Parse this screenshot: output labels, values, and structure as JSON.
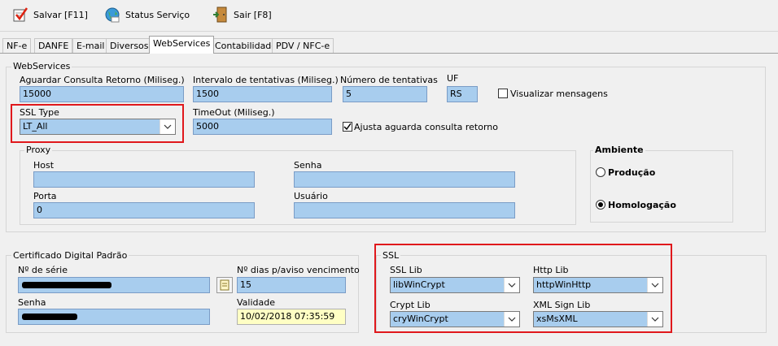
{
  "toolbar": {
    "save_label": "Salvar [F11]",
    "status_label": "Status Serviço",
    "exit_label": "Sair [F8]"
  },
  "tabs": [
    "NF-e",
    "DANFE",
    "E-mail",
    "Diversos",
    "WebServices",
    "Contabilidade",
    "PDV / NFC-e"
  ],
  "active_tab": "WebServices",
  "webservices": {
    "title": "WebServices",
    "aguardar_label": "Aguardar Consulta Retorno (Miliseg.)",
    "aguardar_value": "15000",
    "intervalo_label": "Intervalo de tentativas (Miliseg.)",
    "intervalo_value": "1500",
    "tentativas_label": "Número de tentativas",
    "tentativas_value": "5",
    "uf_label": "UF",
    "uf_value": "RS",
    "visualizar_label": "Visualizar mensagens",
    "visualizar_checked": false,
    "ssltype_label": "SSL Type",
    "ssltype_value": "LT_All",
    "timeout_label": "TimeOut (Miliseg.)",
    "timeout_value": "5000",
    "ajusta_label": "Ajusta aguarda consulta retorno",
    "ajusta_checked": true
  },
  "proxy": {
    "title": "Proxy",
    "host_label": "Host",
    "host_value": "",
    "senha_label": "Senha",
    "senha_value": "",
    "porta_label": "Porta",
    "porta_value": "0",
    "usuario_label": "Usuário",
    "usuario_value": ""
  },
  "ambiente": {
    "title": "Ambiente",
    "producao_label": "Produção",
    "homologacao_label": "Homologação",
    "selected": "Homologação"
  },
  "certificado": {
    "title": "Certificado Digital Padrão",
    "serie_label": "Nº de série",
    "dias_label": "Nº dias p/aviso vencimento",
    "dias_value": "15",
    "senha_label": "Senha",
    "validade_label": "Validade",
    "validade_value": "10/02/2018 07:35:59"
  },
  "ssl": {
    "title": "SSL",
    "ssllib_label": "SSL Lib",
    "ssllib_value": "libWinCrypt",
    "httplib_label": "Http Lib",
    "httplib_value": "httpWinHttp",
    "cryptlib_label": "Crypt Lib",
    "cryptlib_value": "cryWinCrypt",
    "xmlsign_label": "XML Sign Lib",
    "xmlsign_value": "xsMsXML"
  },
  "colors": {
    "field_bg": "#a8cdee",
    "highlight_red": "#e0181c",
    "validade_bg": "#ffffc4"
  }
}
